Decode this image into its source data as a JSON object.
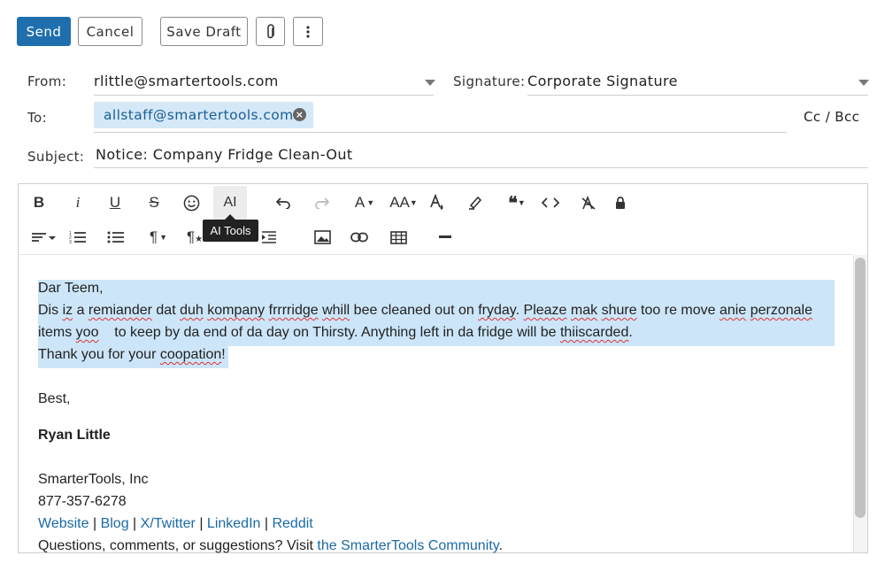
{
  "toolbar": {
    "send": "Send",
    "cancel": "Cancel",
    "save_draft": "Save Draft",
    "attach_icon": "paperclip-icon",
    "more_icon": "more-vertical-icon"
  },
  "header": {
    "from_label": "From:",
    "from_value": "rlittle@smartertools.com",
    "signature_label": "Signature:",
    "signature_value": "Corporate Signature",
    "to_label": "To:",
    "to_chip": "allstaff@smartertools.com",
    "cc_bcc": "Cc / Bcc",
    "subject_label": "Subject:",
    "subject_value": "Notice: Company Fridge Clean-Out"
  },
  "editor_toolbar": {
    "tooltip": "AI Tools",
    "ai_label": "AI",
    "bold": "B",
    "italic": "i",
    "underline": "U",
    "strike": "S",
    "font_a": "A",
    "font_size": "AA",
    "paragraph": "¶",
    "quote": "66"
  },
  "message": {
    "line1": "Dar Teem,",
    "line2_parts": {
      "a": "Dis ",
      "b": "iz",
      "c": " a ",
      "d": "remiander",
      "e": " dat ",
      "f": "duh",
      "g": " ",
      "h": "kompany",
      "i": " ",
      "j": "frrrridge",
      "k": " ",
      "l": "whill",
      "m": " bee cleaned out on ",
      "n": "fryday",
      "o": ". ",
      "p": "Pleaze",
      "q": " ",
      "r": "mak",
      "s": " ",
      "t": "shure",
      "u": " too re move ",
      "v": "anie",
      "w": " ",
      "x": "perzonale"
    },
    "line3_parts": {
      "a": "items ",
      "b": "yoo",
      "c": "    to keep by da end of da day on Thirsty. Anything left in da fridge will be ",
      "d": "thiiscarded",
      "e": "."
    },
    "line4_parts": {
      "a": "Thank you for your ",
      "b": "coopation",
      "c": "!"
    },
    "closing": "Best,",
    "name": "Ryan Little",
    "company": "SmarterTools, Inc",
    "phone": "877-357-6278",
    "links": {
      "website": "Website",
      "blog": "Blog",
      "twitter": "X/Twitter",
      "linkedin": "LinkedIn",
      "reddit": "Reddit",
      "sep": " | "
    },
    "footer_text": "Questions, comments, or suggestions? Visit ",
    "footer_link": "the SmarterTools Community",
    "footer_end": "."
  }
}
